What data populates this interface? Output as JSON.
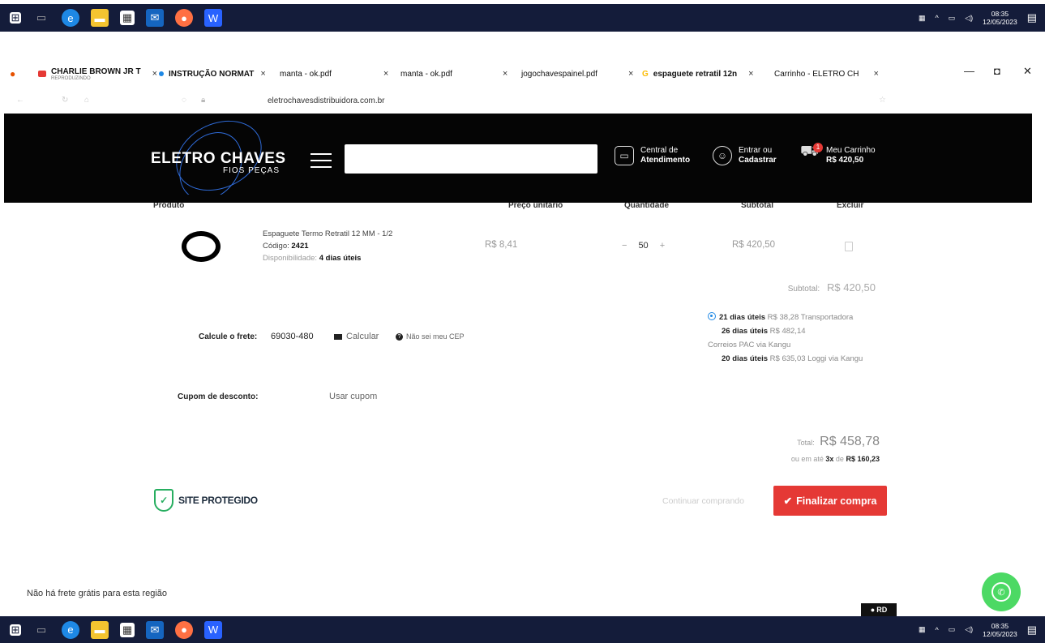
{
  "taskbar": {
    "clock_time": "08:35",
    "clock_date": "12/05/2023"
  },
  "browser": {
    "tabs": [
      {
        "label": "CHARLIE BROWN JR T",
        "sub": "REPRODUZINDO"
      },
      {
        "label": "INSTRUÇÃO NORMAT"
      },
      {
        "label": "manta - ok.pdf"
      },
      {
        "label": "manta - ok.pdf"
      },
      {
        "label": "jogochavespainel.pdf"
      },
      {
        "label": "espaguete retratil 12n"
      },
      {
        "label": "Carrinho - ELETRO CH"
      }
    ],
    "tab_close": "×",
    "url": "eletrochavesdistribuidora.com.br"
  },
  "header": {
    "logo_main": "ELETRO CHAVES",
    "logo_sub": "FIOS PEÇAS",
    "support_line1": "Central de",
    "support_line2": "Atendimento",
    "account_line1": "Entrar ou",
    "account_line2": "Cadastrar",
    "cart_line1": "Meu Carrinho",
    "cart_total": "R$ 420,50",
    "cart_count": "1"
  },
  "table": {
    "headers": {
      "product": "Produto",
      "unit_price": "Preço unitário",
      "quantity": "Quantidade",
      "subtotal": "Subtotal",
      "delete": "Excluir"
    },
    "item": {
      "name": "Espaguete Termo Retratil 12 MM - 1/2",
      "code_label": "Código:",
      "code": "2421",
      "availability_label": "Disponibilidade:",
      "availability": "4 dias úteis",
      "unit_price": "R$ 8,41",
      "qty_minus": "−",
      "quantity": "50",
      "qty_plus": "+",
      "subtotal": "R$ 420,50"
    }
  },
  "summary": {
    "subtotal_label": "Subtotal:",
    "subtotal": "R$ 420,50",
    "total_label": "Total:",
    "total": "R$ 458,78",
    "installments_pre": "ou em até",
    "installments_count": "3x",
    "installments_mid": "de",
    "installments_value": "R$ 160,23"
  },
  "shipping": {
    "label": "Calcule o frete:",
    "cep": "69030-480",
    "calculate": "Calcular",
    "unknown_cep": "Não sei meu CEP",
    "options": [
      {
        "days": "21 dias úteis",
        "price": "R$ 38,28",
        "carrier": "Transportadora"
      },
      {
        "days": "26 dias úteis",
        "price": "R$ 482,14",
        "carrier": "Correios PAC via Kangu"
      },
      {
        "days": "20 dias úteis",
        "price": "R$ 635,03",
        "carrier": "Loggi via Kangu"
      }
    ]
  },
  "coupon": {
    "label": "Cupom de desconto:",
    "link": "Usar cupom"
  },
  "footer": {
    "secure": "SITE PROTEGIDO",
    "continue": "Continuar comprando",
    "finalize": "Finalizar compra",
    "no_free_shipping": "Não há frete grátis para esta região",
    "rd_badge": "RD"
  },
  "colors": {
    "accent": "#e53935",
    "header_bg": "#050505",
    "whatsapp": "#4cd964",
    "secure_green": "#27ae60"
  }
}
